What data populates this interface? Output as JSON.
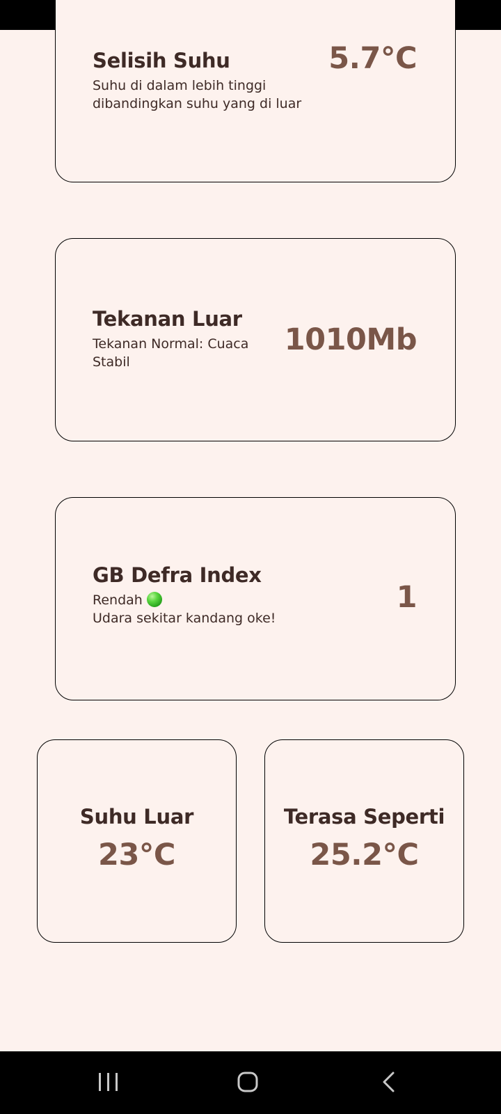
{
  "cards": {
    "selisih": {
      "title": "Selisih Suhu",
      "desc": "Suhu di dalam lebih tinggi dibandingkan suhu yang di luar",
      "value": "5.7°C"
    },
    "tekanan": {
      "title": "Tekanan Luar",
      "desc": "Tekanan Normal: Cuaca Stabil",
      "value": "1010Mb"
    },
    "defra": {
      "title": "GB Defra Index",
      "level": "Rendah",
      "desc": "Udara sekitar kandang oke!",
      "value": "1",
      "level_color": "#3cbf2a"
    },
    "suhu_luar": {
      "title": "Suhu Luar",
      "value": "23°C"
    },
    "terasa": {
      "title": "Terasa Seperti",
      "value": "25.2°C"
    }
  },
  "colors": {
    "background": "#fdf2ee",
    "title_text": "#3e2a26",
    "value_text": "#7a5648",
    "bars": "#000000"
  },
  "nav": {
    "icons": [
      "recents-icon",
      "home-icon",
      "back-icon"
    ]
  }
}
